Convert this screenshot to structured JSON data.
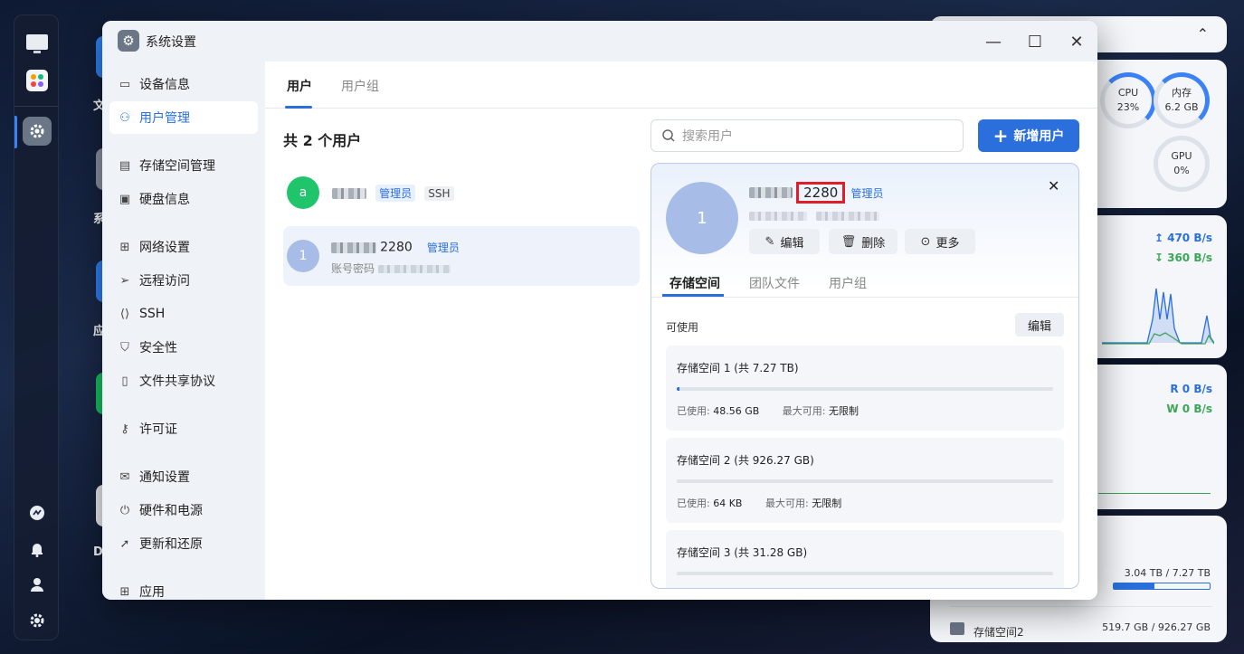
{
  "window": {
    "title": "系统设置"
  },
  "sidebar": {
    "items": [
      {
        "label": "设备信息"
      },
      {
        "label": "用户管理"
      },
      {
        "label": "存储空间管理"
      },
      {
        "label": "硬盘信息"
      },
      {
        "label": "网络设置"
      },
      {
        "label": "远程访问"
      },
      {
        "label": "SSH"
      },
      {
        "label": "安全性"
      },
      {
        "label": "文件共享协议"
      },
      {
        "label": "许可证"
      },
      {
        "label": "通知设置"
      },
      {
        "label": "硬件和电源"
      },
      {
        "label": "更新和还原"
      },
      {
        "label": "应用"
      }
    ]
  },
  "tabs": [
    {
      "label": "用户"
    },
    {
      "label": "用户组"
    }
  ],
  "users": {
    "count_title": "共 2 个用户",
    "list": [
      {
        "avatar": "a",
        "admin_tag": "管理员",
        "ssh_tag": "SSH"
      },
      {
        "avatar": "1",
        "name_suffix": "2280",
        "admin_tag": "管理员",
        "sub_label": "账号密码"
      }
    ]
  },
  "search": {
    "placeholder": "搜索用户"
  },
  "add_button": {
    "label": "新增用户"
  },
  "detail": {
    "avatar": "1",
    "name_suffix": "2280",
    "admin_tag": "管理员",
    "actions": {
      "edit": "编辑",
      "delete": "删除",
      "more": "更多"
    },
    "tabs": [
      {
        "label": "存储空间"
      },
      {
        "label": "团队文件"
      },
      {
        "label": "用户组"
      }
    ],
    "available_label": "可使用",
    "edit_label": "编辑",
    "storage": [
      {
        "title": "存储空间 1 (共 7.27 TB)",
        "used_label": "已使用:",
        "used": "48.56 GB",
        "max_label": "最大可用:",
        "max": "无限制",
        "usage_fraction": 0.006
      },
      {
        "title": "存储空间 2 (共 926.27 GB)",
        "used_label": "已使用:",
        "used": "64 KB",
        "max_label": "最大可用:",
        "max": "无限制",
        "usage_fraction": 0
      },
      {
        "title": "存储空间 3 (共 31.28 GB)"
      }
    ]
  },
  "widgets": {
    "cpu": {
      "label": "CPU",
      "value": "23%"
    },
    "memory": {
      "label": "内存",
      "value": "6.2 GB"
    },
    "gpu": {
      "label": "GPU",
      "value": "0%"
    },
    "network": {
      "up": "470 B/s",
      "down": "360 B/s"
    },
    "disk_io": {
      "read": "R  0 B/s",
      "write": "W  0 B/s"
    },
    "storage": {
      "space1": "3.04 TB / 7.27 TB",
      "space1_fraction": 0.42,
      "space2_label": "存储空间2",
      "space2": "519.7 GB / 926.27 GB"
    }
  },
  "desktop": {
    "labels": [
      "文",
      "系",
      "应",
      "D"
    ]
  },
  "colors": {
    "accent": "#2a6fdb",
    "highlight_box": "#e11d2a",
    "green_avatar": "#1fc46b"
  }
}
